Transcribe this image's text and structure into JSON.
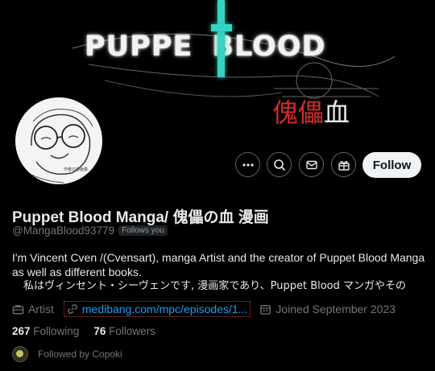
{
  "banner": {
    "title_left": "PUPPE",
    "title_right": "BLOOD",
    "kanji_red": "傀儡",
    "kanji_white": "血",
    "accent_color": "#34d3c3"
  },
  "profile": {
    "avatar_caption": "作者の自画像",
    "name": "Puppet Blood Manga/ 傀儡の血 漫画",
    "handle": "@MangaBlood93779",
    "follows_you": "Follows you",
    "bio_lines": [
      "I'm Vincent Cven /(Cvensart), manga Artist and the creator of Puppet Blood Manga",
      "as well as different  books.",
      "私はヴィンセント・シーヴェンです, 漫画家であり、Puppet Blood マンガやその"
    ],
    "category": "Artist",
    "link": "medibang.com/mpc/episodes/1...",
    "joined": "Joined September 2023",
    "following_count": "267",
    "following_label": "Following",
    "followers_count": "76",
    "followers_label": "Followers",
    "followed_by": "Followed by Copoki"
  },
  "actions": {
    "more_icon": "more-icon",
    "search_icon": "search-icon",
    "message_icon": "mail-icon",
    "subscribe_icon": "gift-icon",
    "follow_label": "Follow"
  }
}
